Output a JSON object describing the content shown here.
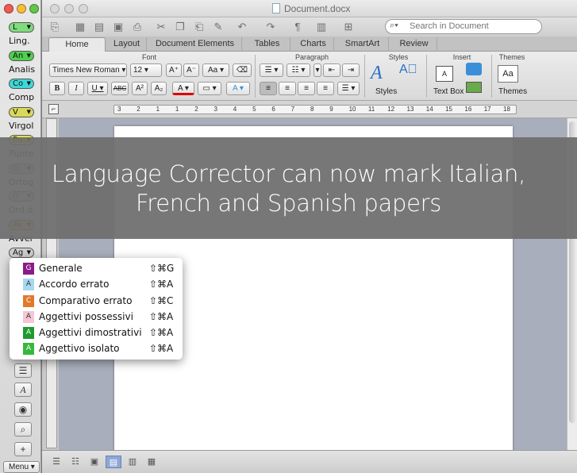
{
  "palette": {
    "items": [
      {
        "type": "pill",
        "label": "L",
        "color": "#7fdc7f"
      },
      {
        "type": "label",
        "label": "Ling."
      },
      {
        "type": "pill",
        "label": "An",
        "color": "#4fd04f"
      },
      {
        "type": "label",
        "label": "Analis"
      },
      {
        "type": "pill",
        "label": "Co",
        "color": "#3ed8d8"
      },
      {
        "type": "label",
        "label": "Comp"
      },
      {
        "type": "pill",
        "label": "V",
        "color": "#d8d85a"
      },
      {
        "type": "label",
        "label": "Virgol"
      },
      {
        "type": "pill",
        "label": "Pu",
        "color": "#e6e04a"
      },
      {
        "type": "label",
        "label": "Punte"
      },
      {
        "type": "pill",
        "label": "O",
        "color": "#cfcfcf"
      },
      {
        "type": "label",
        "label": "Ortog"
      },
      {
        "type": "pill",
        "label": "O",
        "color": "#cfcfcf"
      },
      {
        "type": "label",
        "label": "Ord.d"
      },
      {
        "type": "pill",
        "label": "Av",
        "color": "#f2c055"
      },
      {
        "type": "label",
        "label": "Avver"
      },
      {
        "type": "pill",
        "label": "Ag",
        "color": "#cfcfcf"
      }
    ],
    "menu_label": "Menu"
  },
  "window": {
    "title": "Document.docx",
    "search_placeholder": "Search in Document"
  },
  "tabs": [
    "Home",
    "Layout",
    "Document Elements",
    "Tables",
    "Charts",
    "SmartArt",
    "Review"
  ],
  "ribbon": {
    "groups": [
      "Font",
      "Paragraph",
      "Styles",
      "Insert",
      "Themes"
    ],
    "font_name": "Times New Roman",
    "font_size": "12",
    "styles_label": "Styles",
    "textbox_label": "Text Box",
    "themes_label": "Themes"
  },
  "ruler_ticks": [
    "3",
    "2",
    "1",
    "1",
    "2",
    "3",
    "4",
    "5",
    "6",
    "7",
    "8",
    "9",
    "10",
    "11",
    "12",
    "13",
    "14",
    "15",
    "16",
    "17",
    "18"
  ],
  "banner": {
    "line1": "Language Corrector can now mark Italian,",
    "line2": "French and Spanish papers"
  },
  "popup": {
    "items": [
      {
        "code": "G",
        "label": "Generale",
        "shortcut": "⇧⌘G",
        "color": "#8b1a8b",
        "text_color": "#ffffff"
      },
      {
        "code": "A",
        "label": "Accordo errato",
        "shortcut": "⇧⌘A",
        "color": "#a8d8f0",
        "text_color": "#333333"
      },
      {
        "code": "C",
        "label": "Comparativo errato",
        "shortcut": "⇧⌘C",
        "color": "#e07a2a",
        "text_color": "#ffffff"
      },
      {
        "code": "A",
        "label": "Aggettivi possessivi",
        "shortcut": "⇧⌘A",
        "color": "#f4c6d6",
        "text_color": "#333333"
      },
      {
        "code": "A",
        "label": "Aggettivi dimostrativi",
        "shortcut": "⇧⌘A",
        "color": "#1f9a2e",
        "text_color": "#ffffff"
      },
      {
        "code": "A",
        "label": "Aggettivo isolato",
        "shortcut": "⇧⌘A",
        "color": "#36b83a",
        "text_color": "#ffffff"
      }
    ]
  }
}
